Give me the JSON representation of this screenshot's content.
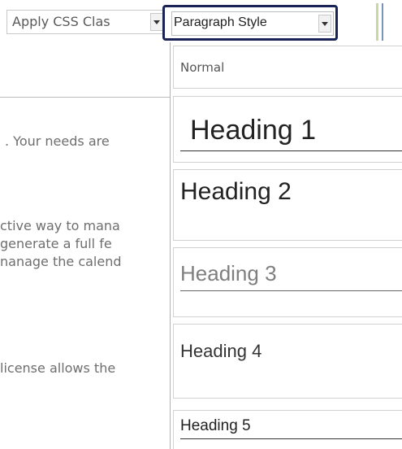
{
  "toolbar": {
    "css_class_combo": {
      "label": "Apply CSS Clas"
    },
    "paragraph_style_combo": {
      "label": "Paragraph Style"
    },
    "separator_colors": [
      "#c9d7a4",
      "#7a93b8"
    ]
  },
  "editor": {
    "lines": [
      ". Your needs are",
      "ctive way to mana",
      "generate a full fe",
      "nanage the calend",
      "license allows the"
    ]
  },
  "dropdown": {
    "options": [
      {
        "label": "Normal"
      },
      {
        "label": "Heading 1"
      },
      {
        "label": "Heading 2"
      },
      {
        "label": "Heading 3"
      },
      {
        "label": "Heading 4"
      },
      {
        "label": "Heading 5"
      }
    ]
  },
  "colors": {
    "focus_border": "#1a2356"
  }
}
